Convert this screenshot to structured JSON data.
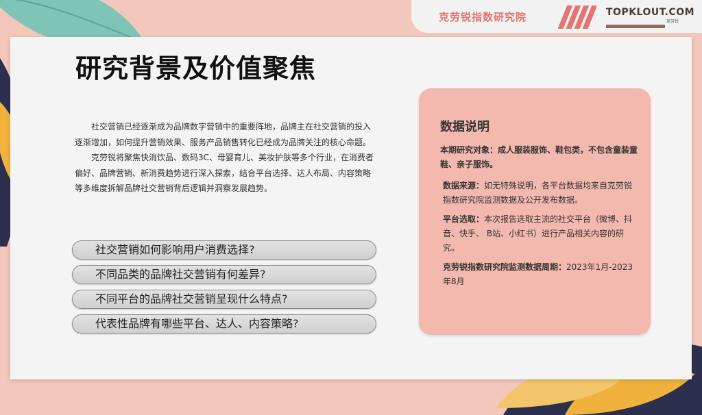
{
  "header": {
    "brand": "克劳锐指数研究院",
    "logo_main": "TOPKLOUT.COM",
    "logo_sub": "克劳锐"
  },
  "slide": {
    "title": "研究背景及价值聚焦",
    "intro_paragraphs": [
      "社交营销已经逐渐成为品牌数字营销中的重要阵地，品牌主在社交营销的投入逐渐增加，如何提升营销效果、服务产品销售转化已经成为品牌关注的核心命题。",
      "克劳锐将聚焦快消饮品、数码3C、母婴育儿、美妆护肤等多个行业，在消费者偏好、品牌营销、新消费趋势进行深入探索，结合平台选择、达人布局、内容策略等多维度拆解品牌社交营销背后逻辑并洞察发展趋势。"
    ],
    "questions": [
      "社交营销如何影响用户消费选择?",
      "不同品类的品牌社交营销有何差异?",
      "不同平台的品牌社交营销呈现什么特点?",
      "代表性品牌有哪些平台、达人、内容策略?"
    ]
  },
  "info": {
    "title": "数据说明",
    "scope": "本期研究对象：成人服装服饰、鞋包类，不包含童装童鞋、亲子服饰。",
    "source_label": "数据来源：",
    "source_text": "如无特殊说明，各平台数据均来自克劳锐指数研究院监测数据及公开发布数据。",
    "platform_label": "平台选取：",
    "platform_text": "本次报告选取主流的社交平台（微博、抖音、快手、 B站、小红书）进行产品相关内容的研究。",
    "period_label": "克劳锐指数研究院监测数据周期：",
    "period_text": "2023年1月-2023年8月"
  },
  "colors": {
    "accent": "#e27570",
    "info_bg": "#f3b8ae",
    "page_bg": "#f3c7bb"
  }
}
